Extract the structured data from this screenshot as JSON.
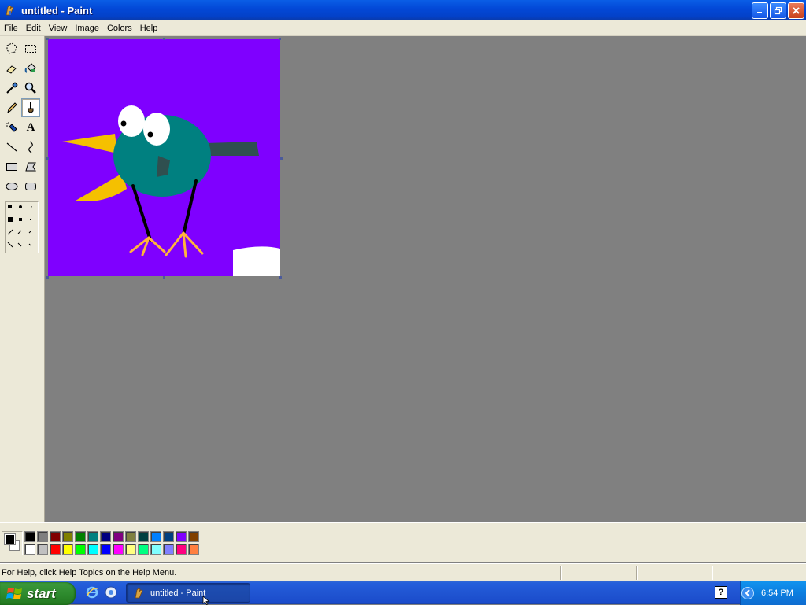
{
  "window": {
    "title": "untitled - Paint",
    "buttons": [
      "minimize",
      "maximize",
      "close"
    ]
  },
  "menubar": {
    "items": [
      "File",
      "Edit",
      "View",
      "Image",
      "Colors",
      "Help"
    ]
  },
  "toolbox": {
    "tools": [
      {
        "name": "free-form-select",
        "icon": "free-select-icon"
      },
      {
        "name": "select",
        "icon": "rect-select-icon"
      },
      {
        "name": "eraser",
        "icon": "eraser-icon"
      },
      {
        "name": "fill",
        "icon": "fill-bucket-icon"
      },
      {
        "name": "pick-color",
        "icon": "eyedropper-icon"
      },
      {
        "name": "magnifier",
        "icon": "magnifier-icon"
      },
      {
        "name": "pencil",
        "icon": "pencil-icon"
      },
      {
        "name": "brush",
        "icon": "brush-icon",
        "active": true
      },
      {
        "name": "airbrush",
        "icon": "airbrush-icon"
      },
      {
        "name": "text",
        "icon": "text-icon",
        "glyph": "A"
      },
      {
        "name": "line",
        "icon": "line-icon"
      },
      {
        "name": "curve",
        "icon": "curve-icon"
      },
      {
        "name": "rectangle",
        "icon": "rectangle-icon"
      },
      {
        "name": "polygon",
        "icon": "polygon-icon"
      },
      {
        "name": "ellipse",
        "icon": "ellipse-icon"
      },
      {
        "name": "rounded-rectangle",
        "icon": "rounded-rect-icon"
      }
    ]
  },
  "colors": {
    "foreground": "#000000",
    "background": "#ffffff",
    "palette_top": [
      "#000000",
      "#808080",
      "#800000",
      "#808000",
      "#008000",
      "#008080",
      "#000080",
      "#800080",
      "#808040",
      "#004040",
      "#0080ff",
      "#004080",
      "#8000ff",
      "#804000"
    ],
    "palette_bottom": [
      "#ffffff",
      "#c0c0c0",
      "#ff0000",
      "#ffff00",
      "#00ff00",
      "#00ffff",
      "#0000ff",
      "#ff00ff",
      "#ffff80",
      "#00ff80",
      "#80ffff",
      "#8080ff",
      "#ff0080",
      "#ff8040"
    ]
  },
  "drawing": {
    "background": "#7f00ff",
    "body": "#008080",
    "beak": "#f5c000",
    "legs": "#000000",
    "feet": "#ffb43c",
    "tail": "#2f4f4f",
    "eye": "#ffffff"
  },
  "statusbar": {
    "text": "For Help, click Help Topics on the Help Menu."
  },
  "taskbar": {
    "start_label": "start",
    "app_label": "untitled - Paint",
    "clock": "6:54 PM"
  }
}
